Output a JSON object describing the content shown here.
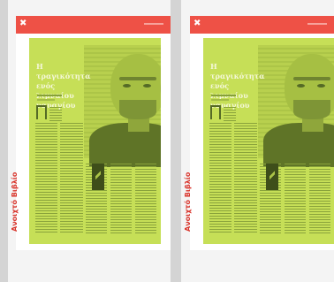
{
  "viewer": {
    "pages": [
      {
        "logo": "✖",
        "headline": "Η τραγικότητα ενός λιμναίου ναυαγίου",
        "section_label": "Ανοιχτό Βιβλίο"
      },
      {
        "logo": "✖",
        "headline": "Η τραγικότητα ενός λιμναίου ναυαγίου",
        "section_label": "Ανοιχτό Βιβλίο"
      }
    ]
  },
  "colors": {
    "accent": "#ee5146",
    "overlay": "#c6df57",
    "section_label": "#d9342b"
  }
}
